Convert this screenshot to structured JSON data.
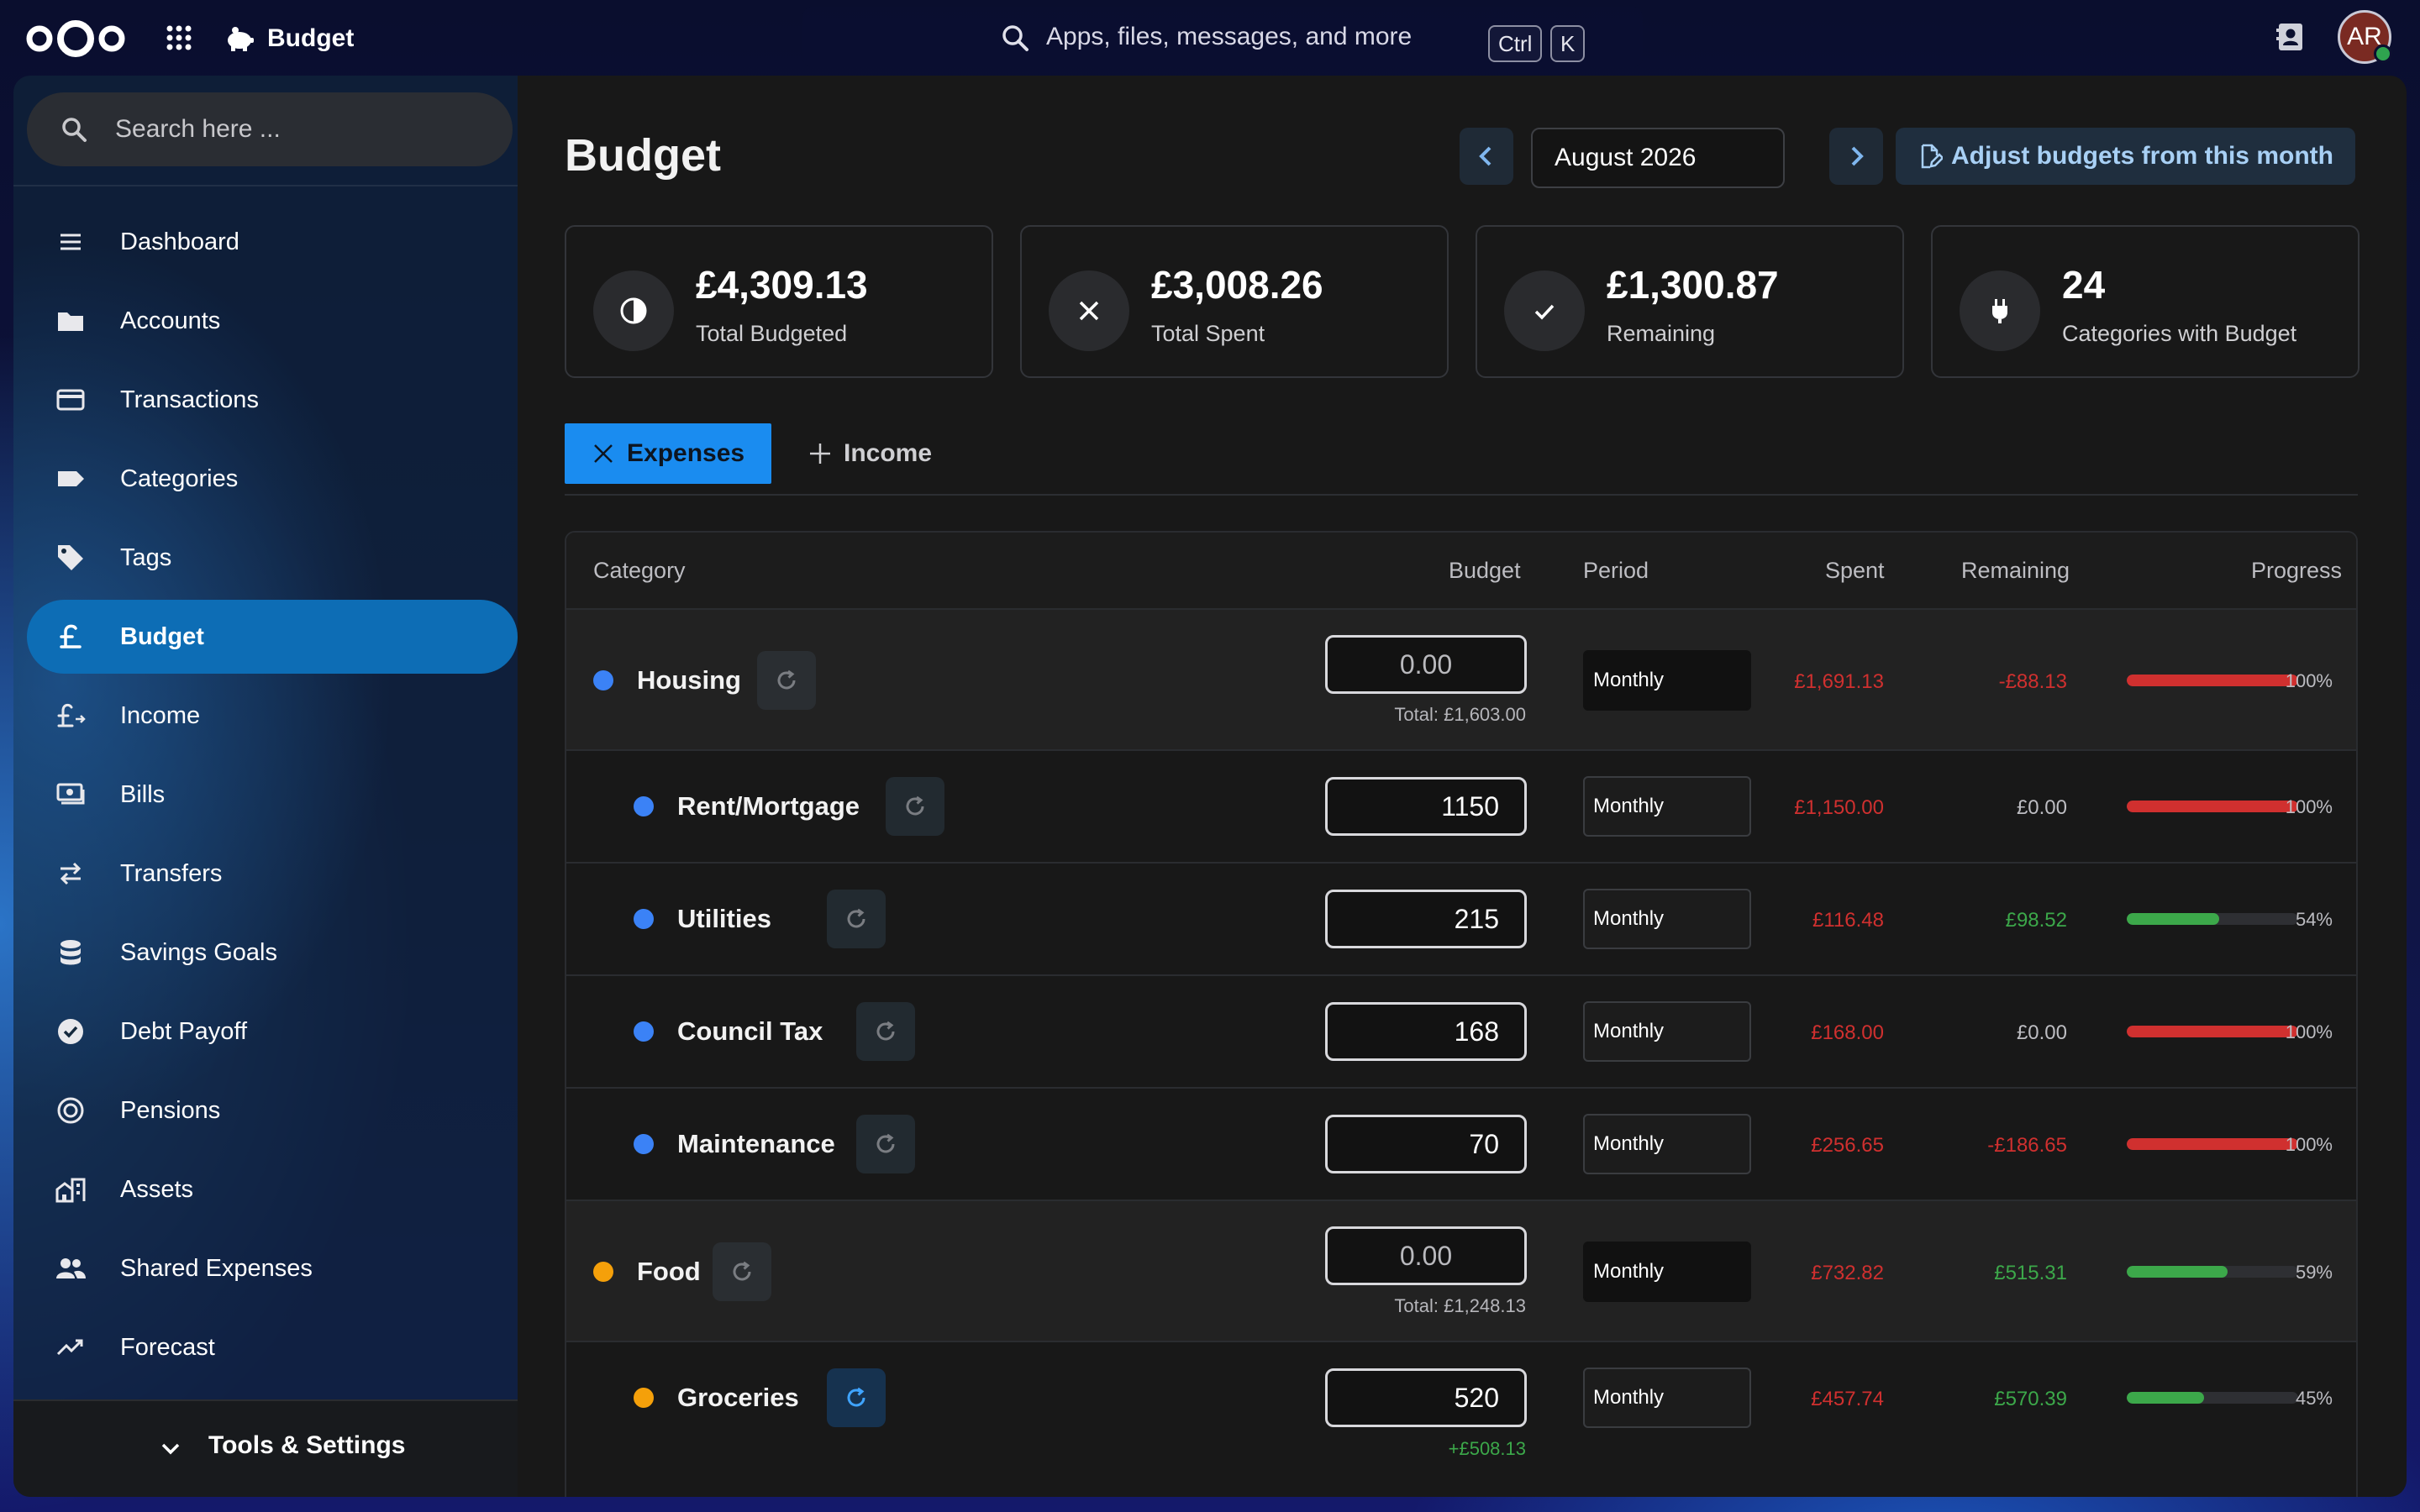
{
  "header": {
    "app_name": "Budget",
    "search_placeholder": "Apps, files, messages, and more",
    "shortcut_key1": "Ctrl",
    "shortcut_key2": "K",
    "avatar_initials": "AR"
  },
  "sidebar": {
    "search_placeholder": "Search here ...",
    "items": [
      {
        "label": "Dashboard",
        "icon": "menu-icon"
      },
      {
        "label": "Accounts",
        "icon": "folder-icon"
      },
      {
        "label": "Transactions",
        "icon": "credit-card-icon"
      },
      {
        "label": "Categories",
        "icon": "label-icon"
      },
      {
        "label": "Tags",
        "icon": "tag-icon"
      },
      {
        "label": "Budget",
        "icon": "pound-icon",
        "active": true
      },
      {
        "label": "Income",
        "icon": "pound-arrow-icon"
      },
      {
        "label": "Bills",
        "icon": "cash-icon"
      },
      {
        "label": "Transfers",
        "icon": "transfer-icon"
      },
      {
        "label": "Savings Goals",
        "icon": "database-icon"
      },
      {
        "label": "Debt Payoff",
        "icon": "check-circle-icon"
      },
      {
        "label": "Pensions",
        "icon": "ring-icon"
      },
      {
        "label": "Assets",
        "icon": "home-city-icon"
      },
      {
        "label": "Shared Expenses",
        "icon": "people-icon"
      },
      {
        "label": "Forecast",
        "icon": "trend-icon"
      }
    ],
    "footer_label": "Tools & Settings"
  },
  "main": {
    "title": "Budget",
    "month": "August 2026",
    "adjust_label": "Adjust budgets from this month",
    "cards": [
      {
        "value": "£4,309.13",
        "label": "Total Budgeted",
        "icon": "pie-icon"
      },
      {
        "value": "£3,008.26",
        "label": "Total Spent",
        "icon": "close-icon"
      },
      {
        "value": "£1,300.87",
        "label": "Remaining",
        "icon": "check-icon"
      },
      {
        "value": "24",
        "label": "Categories with Budget",
        "icon": "plug-icon"
      }
    ],
    "tabs": {
      "expenses": "Expenses",
      "income": "Income"
    },
    "columns": {
      "category": "Category",
      "budget": "Budget",
      "period": "Period",
      "spent": "Spent",
      "remaining": "Remaining",
      "progress": "Progress"
    },
    "rows": [
      {
        "name": "Housing",
        "parent": true,
        "dot": "#3b82f6",
        "budget": "",
        "budget_placeholder": "0.00",
        "total": "Total: £1,603.00",
        "period": "Monthly",
        "spent": "£1,691.13",
        "remaining": "-£88.13",
        "remaining_state": "neg",
        "progress": 1.0,
        "progress_label": "100%"
      },
      {
        "name": "Rent/Mortgage",
        "parent": false,
        "dot": "#3b82f6",
        "budget": "1150",
        "total": "",
        "period": "Monthly",
        "spent": "£1,150.00",
        "remaining": "£0.00",
        "remaining_state": "zero",
        "progress": 1.0,
        "progress_label": "100%"
      },
      {
        "name": "Utilities",
        "parent": false,
        "dot": "#3b82f6",
        "budget": "215",
        "total": "",
        "period": "Monthly",
        "spent": "£116.48",
        "remaining": "£98.52",
        "remaining_state": "pos",
        "progress": 0.54,
        "progress_label": "54%"
      },
      {
        "name": "Council Tax",
        "parent": false,
        "dot": "#3b82f6",
        "budget": "168",
        "total": "",
        "period": "Monthly",
        "spent": "£168.00",
        "remaining": "£0.00",
        "remaining_state": "zero",
        "progress": 1.0,
        "progress_label": "100%"
      },
      {
        "name": "Maintenance",
        "parent": false,
        "dot": "#3b82f6",
        "budget": "70",
        "total": "",
        "period": "Monthly",
        "spent": "£256.65",
        "remaining": "-£186.65",
        "remaining_state": "neg",
        "progress": 1.0,
        "progress_label": "100%"
      },
      {
        "name": "Food",
        "parent": true,
        "dot": "#f5a00a",
        "budget": "",
        "budget_placeholder": "0.00",
        "total": "Total: £1,248.13",
        "period": "Monthly",
        "spent": "£732.82",
        "remaining": "£515.31",
        "remaining_state": "pos",
        "progress": 0.59,
        "progress_label": "59%"
      },
      {
        "name": "Groceries",
        "parent": false,
        "dot": "#f5a00a",
        "budget": "520",
        "total": "+£508.13",
        "total_green": true,
        "period": "Monthly",
        "spent": "£457.74",
        "remaining": "£570.39",
        "remaining_state": "pos",
        "progress": 0.45,
        "progress_label": "45%",
        "rollover_active": true
      }
    ]
  },
  "colors": {
    "accent": "#1a8cf0",
    "active_nav": "#0d6db5",
    "negative": "#d0302f",
    "positive": "#3ca84a"
  }
}
